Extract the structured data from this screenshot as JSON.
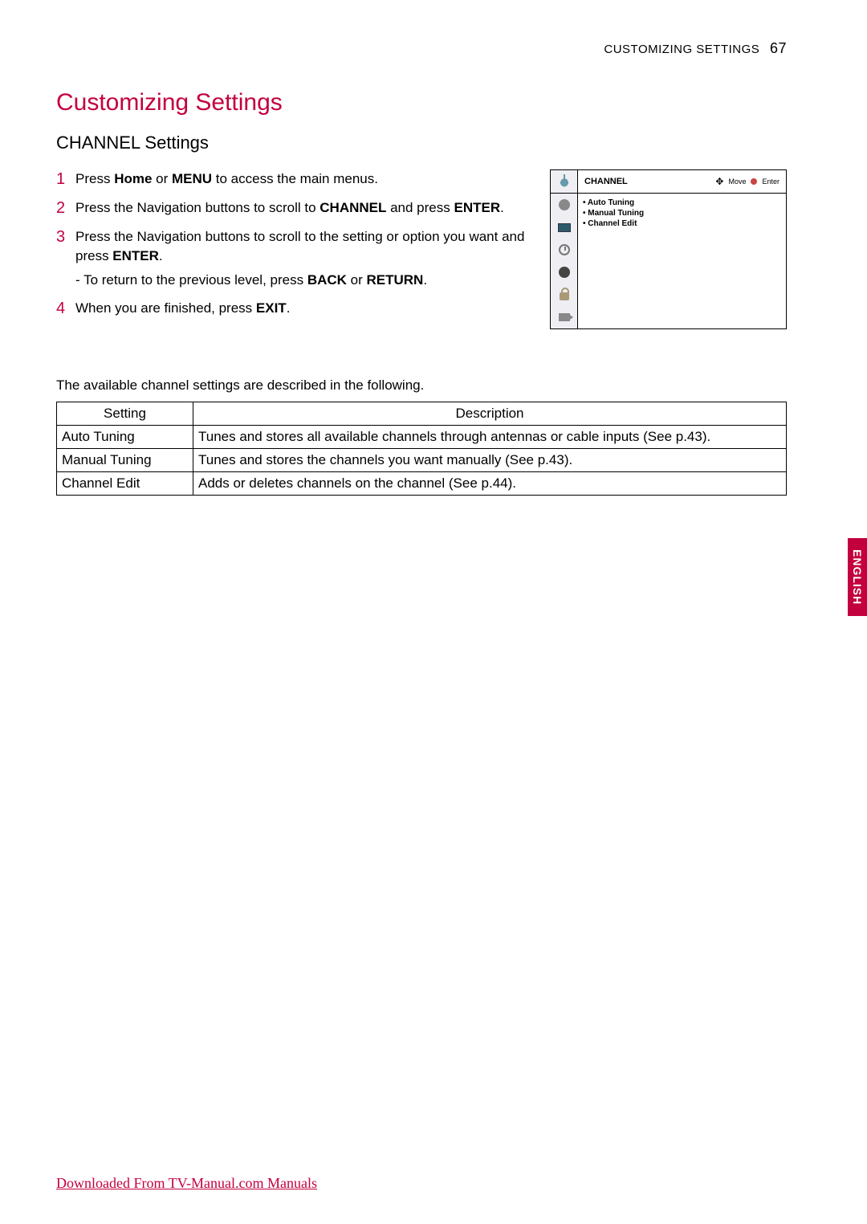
{
  "header": {
    "running_head": "CUSTOMIZING SETTINGS",
    "page_number": "67"
  },
  "title": "Customizing Settings",
  "section": "CHANNEL Settings",
  "steps": [
    {
      "num": "1",
      "prefix": "Press ",
      "b1": "Home",
      "mid1": " or ",
      "b2": "MENU",
      "suffix": " to access the main menus."
    },
    {
      "num": "2",
      "prefix": "Press the Navigation buttons to scroll to ",
      "b1": "CHANNEL",
      "mid1": " and press ",
      "b2": "ENTER",
      "suffix": "."
    },
    {
      "num": "3",
      "prefix": "Press the Navigation buttons to scroll to the setting or option you want and press ",
      "b1": "ENTER",
      "suffix": ".",
      "sub_prefix": "- To return to the previous level, press ",
      "sub_b1": "BACK",
      "sub_mid": " or ",
      "sub_b2": "RETURN",
      "sub_suffix": "."
    },
    {
      "num": "4",
      "prefix": "When you are finished, press ",
      "b1": "EXIT",
      "suffix": "."
    }
  ],
  "osd": {
    "title": "CHANNEL",
    "hint_move": "Move",
    "hint_enter": "Enter",
    "items": [
      "Auto Tuning",
      "Manual Tuning",
      "Channel Edit"
    ],
    "side_icons": [
      "antenna-icon",
      "speaker-icon",
      "screen-icon",
      "clock-icon",
      "dot-icon",
      "lock-icon",
      "input-icon"
    ]
  },
  "intro_line": "The available channel settings are described in the following.",
  "table": {
    "headers": [
      "Setting",
      "Description"
    ],
    "rows": [
      [
        "Auto Tuning",
        "Tunes and stores all available channels through antennas or cable inputs (See p.43)."
      ],
      [
        "Manual Tuning",
        "Tunes and stores the channels you want manually (See p.43)."
      ],
      [
        "Channel Edit",
        "Adds or deletes channels on the channel (See p.44)."
      ]
    ]
  },
  "side_tab": "ENGLISH",
  "footer_link": "Downloaded From TV-Manual.com Manuals"
}
